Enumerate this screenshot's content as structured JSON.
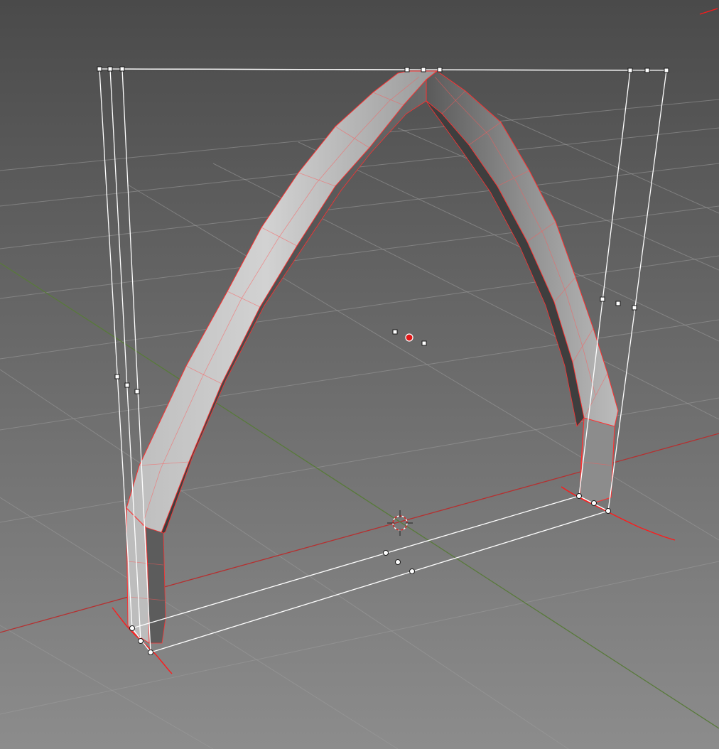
{
  "viewport": {
    "mode": "3d-perspective",
    "object": "pointed-arch-mesh",
    "selection": "lattice-cage",
    "show_grid": true,
    "show_x_axis": true,
    "show_y_axis": true,
    "show_3d_cursor": true
  },
  "colors": {
    "background_top": "#4a4a4a",
    "background_bottom": "#8a8a8a",
    "grid": "#9a9a9a",
    "x_axis": "#b03030",
    "y_axis": "#5a7a3a",
    "mesh_light": "#c8c8c8",
    "mesh_dark": "#4a4a4a",
    "selection_edge": "#ff2020",
    "cage_line": "#ffffff",
    "handle_fill": "#ffffff",
    "origin": "#e01818"
  }
}
